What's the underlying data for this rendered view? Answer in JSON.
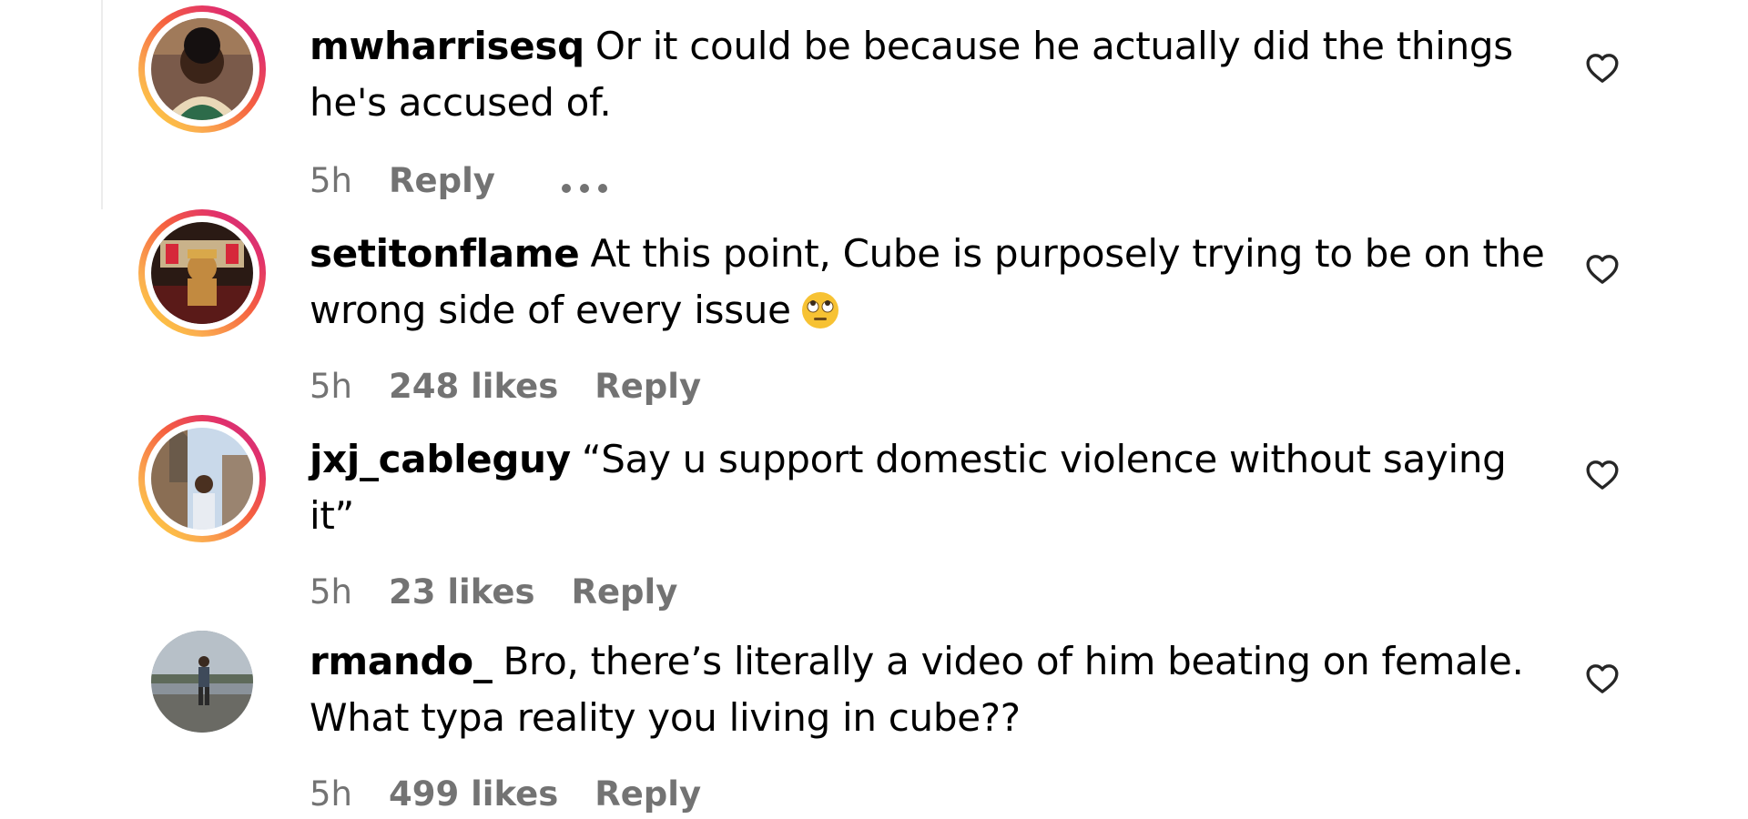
{
  "comments": [
    {
      "username": "mwharrisesq",
      "text": "Or it could be because he actually did the things he's accused of.",
      "time": "5h",
      "likes": "",
      "reply": "Reply",
      "story_ring": true
    },
    {
      "username": "setitonflame",
      "text": "At this point, Cube is purposely trying to be on the wrong side of every issue",
      "time": "5h",
      "likes": "248 likes",
      "reply": "Reply",
      "emoji": "face-with-rolling-eyes",
      "story_ring": true
    },
    {
      "username": "jxj_cableguy",
      "text": "“Say u support domestic violence without saying it”",
      "time": "5h",
      "likes": "23 likes",
      "reply": "Reply",
      "story_ring": true
    },
    {
      "username": "rmando_",
      "text": "Bro, there’s literally a video of him beating on female. What typa reality you living in cube??",
      "time": "5h",
      "likes": "499 likes",
      "reply": "Reply",
      "story_ring": false
    }
  ],
  "icons": {
    "like": "heart-outline-icon",
    "more": "more-options-icon"
  },
  "colors": {
    "text": "#000000",
    "meta": "#737373",
    "ring_start": "#fdd835",
    "ring_mid": "#f56040",
    "ring_end": "#c13584"
  }
}
